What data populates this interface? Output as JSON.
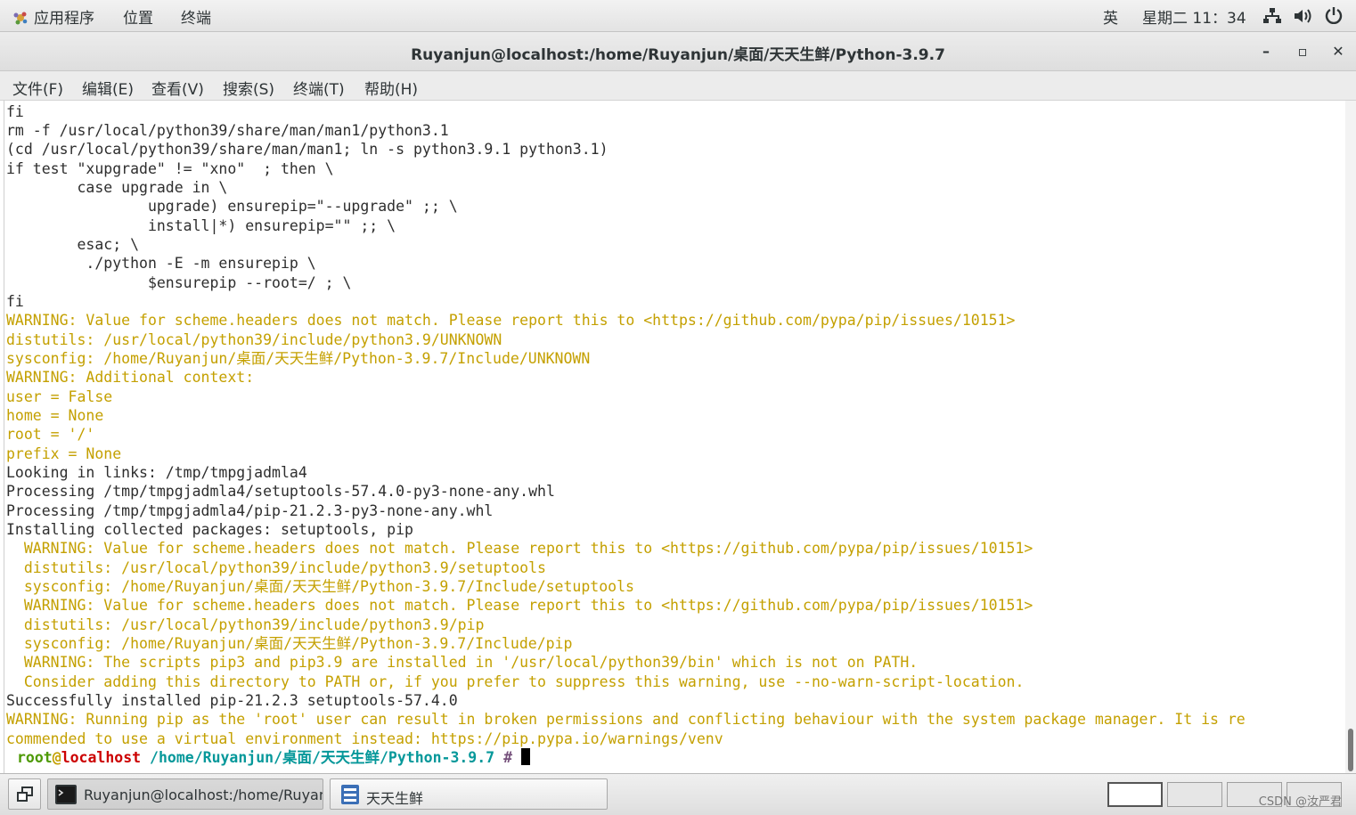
{
  "top_panel": {
    "applications": "应用程序",
    "places": "位置",
    "terminal": "终端",
    "input_method": "英",
    "clock": "星期二 11：34"
  },
  "window": {
    "title": "Ruyanjun@localhost:/home/Ruyanjun/桌面/天天生鲜/Python-3.9.7",
    "minimize": "–",
    "maximize": "▫",
    "close": "✕"
  },
  "menu": {
    "file": "文件(F)",
    "edit": "编辑(E)",
    "view": "查看(V)",
    "search": "搜索(S)",
    "terminal": "终端(T)",
    "help": "帮助(H)"
  },
  "terminal": {
    "lines": [
      "fi",
      "rm -f /usr/local/python39/share/man/man1/python3.1",
      "(cd /usr/local/python39/share/man/man1; ln -s python3.9.1 python3.1)",
      "if test \"xupgrade\" != \"xno\"  ; then \\",
      "        case upgrade in \\",
      "                upgrade) ensurepip=\"--upgrade\" ;; \\",
      "                install|*) ensurepip=\"\" ;; \\",
      "        esac; \\",
      "         ./python -E -m ensurepip \\",
      "                $ensurepip --root=/ ; \\",
      "fi",
      "WARNING: Value for scheme.headers does not match. Please report this to <https://github.com/pypa/pip/issues/10151>",
      "distutils: /usr/local/python39/include/python3.9/UNKNOWN",
      "sysconfig: /home/Ruyanjun/桌面/天天生鲜/Python-3.9.7/Include/UNKNOWN",
      "WARNING: Additional context:",
      "user = False",
      "home = None",
      "root = '/'",
      "prefix = None",
      "Looking in links: /tmp/tmpgjadmla4",
      "Processing /tmp/tmpgjadmla4/setuptools-57.4.0-py3-none-any.whl",
      "Processing /tmp/tmpgjadmla4/pip-21.2.3-py3-none-any.whl",
      "Installing collected packages: setuptools, pip",
      "  WARNING: Value for scheme.headers does not match. Please report this to <https://github.com/pypa/pip/issues/10151>",
      "  distutils: /usr/local/python39/include/python3.9/setuptools",
      "  sysconfig: /home/Ruyanjun/桌面/天天生鲜/Python-3.9.7/Include/setuptools",
      "  WARNING: Value for scheme.headers does not match. Please report this to <https://github.com/pypa/pip/issues/10151>",
      "  distutils: /usr/local/python39/include/python3.9/pip",
      "  sysconfig: /home/Ruyanjun/桌面/天天生鲜/Python-3.9.7/Include/pip",
      "  WARNING: The scripts pip3 and pip3.9 are installed in '/usr/local/python39/bin' which is not on PATH.",
      "  Consider adding this directory to PATH or, if you prefer to suppress this warning, use --no-warn-script-location.",
      "Successfully installed pip-21.2.3 setuptools-57.4.0",
      "WARNING: Running pip as the 'root' user can result in broken permissions and conflicting behaviour with the system package manager. It is re",
      "commended to use a virtual environment instead: https://pip.pypa.io/warnings/venv"
    ],
    "warn_lines": [
      11,
      12,
      13,
      14,
      15,
      16,
      17,
      18,
      23,
      24,
      25,
      26,
      27,
      28,
      29,
      30,
      32,
      33
    ],
    "prompt": {
      "user": "root",
      "at": "@",
      "host": "localhost",
      "path": "/home/Ruyanjun/桌面/天天生鲜/Python-3.9.7",
      "symbol": "#"
    }
  },
  "taskbar": {
    "task1": "Ruyanjun@localhost:/home/Ruyanju···",
    "task2": "天天生鲜",
    "watermark": "CSDN @汝严君"
  }
}
